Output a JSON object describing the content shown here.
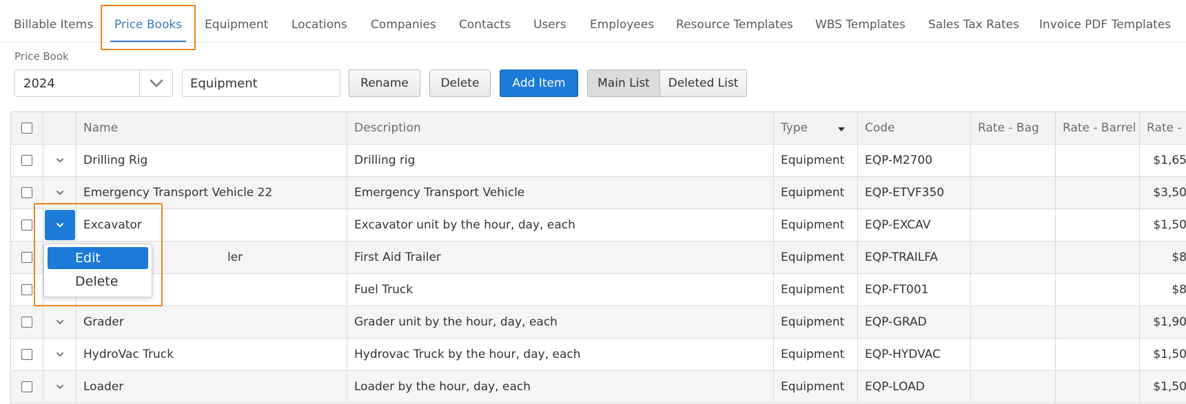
{
  "tabs": [
    {
      "label": "Billable Items",
      "active": false
    },
    {
      "label": "Price Books",
      "active": true
    },
    {
      "label": "Equipment",
      "active": false
    },
    {
      "label": "Locations",
      "active": false
    },
    {
      "label": "Companies",
      "active": false
    },
    {
      "label": "Contacts",
      "active": false
    },
    {
      "label": "Users",
      "active": false
    },
    {
      "label": "Employees",
      "active": false
    },
    {
      "label": "Resource Templates",
      "active": false
    },
    {
      "label": "WBS Templates",
      "active": false
    },
    {
      "label": "Sales Tax Rates",
      "active": false
    },
    {
      "label": "Invoice PDF Templates",
      "active": false
    }
  ],
  "price_book": {
    "label": "Price Book",
    "selected": "2024",
    "name_value": "Equipment",
    "rename_label": "Rename",
    "delete_label": "Delete",
    "add_item_label": "Add Item",
    "main_list_label": "Main List",
    "deleted_list_label": "Deleted List"
  },
  "grid": {
    "columns": [
      "Name",
      "Description",
      "Type",
      "Code",
      "Rate - Bag",
      "Rate - Barrel",
      "Rate - D"
    ],
    "rows": [
      {
        "name": "Drilling Rig",
        "description": "Drilling rig",
        "type": "Equipment",
        "code": "EQP-M2700",
        "rate_bag": "",
        "rate_barrel": "",
        "rate_d": "$1,65"
      },
      {
        "name": "Emergency Transport Vehicle 22",
        "description": "Emergency Transport Vehicle",
        "type": "Equipment",
        "code": "EQP-ETVF350",
        "rate_bag": "",
        "rate_barrel": "",
        "rate_d": "$3,50"
      },
      {
        "name": "Excavator",
        "description": "Excavator unit by the hour, day, each",
        "type": "Equipment",
        "code": "EQP-EXCAV",
        "rate_bag": "",
        "rate_barrel": "",
        "rate_d": "$1,50"
      },
      {
        "name": "ler",
        "description": "First Aid Trailer",
        "type": "Equipment",
        "code": "EQP-TRAILFA",
        "rate_bag": "",
        "rate_barrel": "",
        "rate_d": "$8"
      },
      {
        "name": "",
        "description": "Fuel Truck",
        "type": "Equipment",
        "code": "EQP-FT001",
        "rate_bag": "",
        "rate_barrel": "",
        "rate_d": "$8"
      },
      {
        "name": "Grader",
        "description": "Grader unit by the hour, day, each",
        "type": "Equipment",
        "code": "EQP-GRAD",
        "rate_bag": "",
        "rate_barrel": "",
        "rate_d": "$1,90"
      },
      {
        "name": "HydroVac Truck",
        "description": "Hydrovac Truck by the hour, day, each",
        "type": "Equipment",
        "code": "EQP-HYDVAC",
        "rate_bag": "",
        "rate_barrel": "",
        "rate_d": "$1,50"
      },
      {
        "name": "Loader",
        "description": "Loader by the hour, day, each",
        "type": "Equipment",
        "code": "EQP-LOAD",
        "rate_bag": "",
        "rate_barrel": "",
        "rate_d": "$1,50"
      }
    ]
  },
  "row_menu": {
    "edit_label": "Edit",
    "delete_label": "Delete"
  },
  "colors": {
    "accent": "#1c7ad8",
    "highlight": "#f0821e",
    "active_tab": "#3a7bc1"
  }
}
